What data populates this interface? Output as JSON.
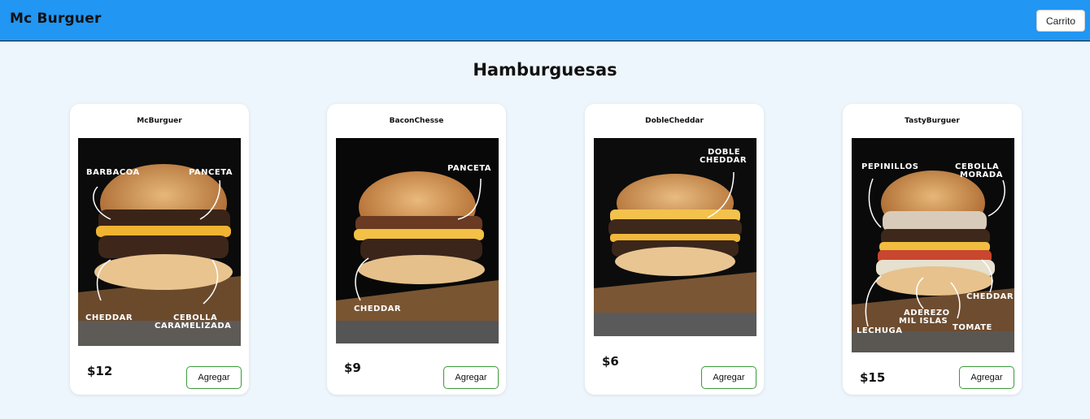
{
  "navbar": {
    "brand": "Mc Burguer",
    "cart_label": "Carrito"
  },
  "section": {
    "title": "Hamburguesas"
  },
  "colors": {
    "navbar": "#2196f3",
    "background": "#eef6fd",
    "button_border": "#3a9a3a"
  },
  "products": [
    {
      "name": "McBurguer",
      "price": "$12",
      "button": "Agregar",
      "image_labels": [
        "BARBACOA",
        "PANCETA",
        "CHEDDAR",
        "CEBOLLA",
        "CARAMELIZADA"
      ]
    },
    {
      "name": "BaconChesse",
      "price": "$9",
      "button": "Agregar",
      "image_labels": [
        "PANCETA",
        "CHEDDAR"
      ]
    },
    {
      "name": "DobleCheddar",
      "price": "$6",
      "button": "Agregar",
      "image_labels": [
        "DOBLE",
        "CHEDDAR"
      ]
    },
    {
      "name": "TastyBurguer",
      "price": "$15",
      "button": "Agregar",
      "image_labels": [
        "PEPINILLOS",
        "CEBOLLA",
        "MORADA",
        "ADEREZO",
        "MIL ISLAS",
        "CHEDDAR",
        "LECHUGA",
        "TOMATE"
      ]
    }
  ]
}
